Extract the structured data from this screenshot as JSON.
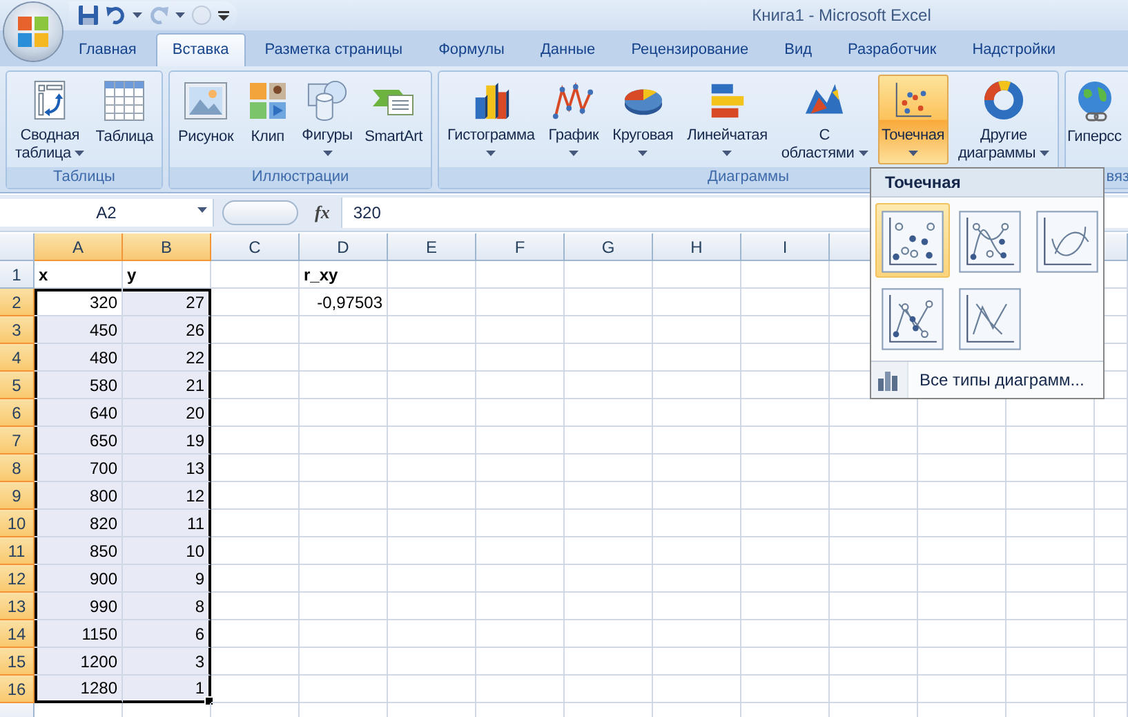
{
  "window": {
    "title": "Книга1 - Microsoft Excel"
  },
  "quick_access": [
    {
      "kind": "save",
      "disabled": false
    },
    {
      "kind": "undo",
      "disabled": false
    },
    {
      "kind": "redo",
      "disabled": true
    },
    {
      "kind": "repeat",
      "disabled": true
    }
  ],
  "tabs": [
    {
      "label": "Главная",
      "selected": false
    },
    {
      "label": "Вставка",
      "selected": true
    },
    {
      "label": "Разметка страницы",
      "selected": false
    },
    {
      "label": "Формулы",
      "selected": false
    },
    {
      "label": "Данные",
      "selected": false
    },
    {
      "label": "Рецензирование",
      "selected": false
    },
    {
      "label": "Вид",
      "selected": false
    },
    {
      "label": "Разработчик",
      "selected": false
    },
    {
      "label": "Надстройки",
      "selected": false
    }
  ],
  "ribbon_groups": [
    {
      "label": "Таблицы",
      "buttons": [
        {
          "kind": "pivot",
          "lines": [
            "Сводная",
            "таблица"
          ],
          "dropdown": true,
          "pressed": false
        },
        {
          "kind": "table",
          "lines": [
            "Таблица"
          ],
          "dropdown": false,
          "pressed": false
        }
      ]
    },
    {
      "label": "Иллюстрации",
      "buttons": [
        {
          "kind": "picture",
          "lines": [
            "Рисунок"
          ],
          "dropdown": false,
          "pressed": false
        },
        {
          "kind": "clip",
          "lines": [
            "Клип"
          ],
          "dropdown": false,
          "pressed": false
        },
        {
          "kind": "shapes",
          "lines": [
            "Фигуры"
          ],
          "dropdown": true,
          "pressed": false
        },
        {
          "kind": "smartart",
          "lines": [
            "SmartArt"
          ],
          "dropdown": false,
          "pressed": false
        }
      ]
    },
    {
      "label": "Диаграммы",
      "buttons": [
        {
          "kind": "column",
          "lines": [
            "Гистограмма"
          ],
          "dropdown": true,
          "pressed": false
        },
        {
          "kind": "line",
          "lines": [
            "График"
          ],
          "dropdown": true,
          "pressed": false
        },
        {
          "kind": "pie",
          "lines": [
            "Круговая"
          ],
          "dropdown": true,
          "pressed": false
        },
        {
          "kind": "bar",
          "lines": [
            "Линейчатая"
          ],
          "dropdown": true,
          "pressed": false
        },
        {
          "kind": "area",
          "lines": [
            "С",
            "областями"
          ],
          "dropdown": true,
          "pressed": false
        },
        {
          "kind": "scatter",
          "lines": [
            "Точечная"
          ],
          "dropdown": true,
          "pressed": true
        },
        {
          "kind": "other",
          "lines": [
            "Другие",
            "диаграммы"
          ],
          "dropdown": true,
          "pressed": false
        }
      ]
    },
    {
      "label": "вяз",
      "buttons": [
        {
          "kind": "hyperlink",
          "lines": [
            "Гиперсс"
          ],
          "dropdown": false,
          "pressed": false
        }
      ]
    }
  ],
  "formula_bar": {
    "name_box": "A2",
    "function_label": "fx",
    "value": "320"
  },
  "sheet": {
    "columns": [
      {
        "label": "A",
        "selected": true
      },
      {
        "label": "B",
        "selected": true
      },
      {
        "label": "C",
        "selected": false
      },
      {
        "label": "D",
        "selected": false
      },
      {
        "label": "E",
        "selected": false
      },
      {
        "label": "F",
        "selected": false
      },
      {
        "label": "G",
        "selected": false
      },
      {
        "label": "H",
        "selected": false
      },
      {
        "label": "I",
        "selected": false
      }
    ],
    "rows": [
      {
        "number": "1",
        "kind": "header",
        "selected": false,
        "cell_a": "x",
        "cell_b": "y",
        "cell_d": "r_xy"
      },
      {
        "number": "2",
        "kind": "data",
        "selected": true,
        "cell_a": "320",
        "cell_b": "27",
        "cell_d": "-0,97503"
      },
      {
        "number": "3",
        "kind": "data",
        "selected": true,
        "cell_a": "450",
        "cell_b": "26"
      },
      {
        "number": "4",
        "kind": "data",
        "selected": true,
        "cell_a": "480",
        "cell_b": "22"
      },
      {
        "number": "5",
        "kind": "data",
        "selected": true,
        "cell_a": "580",
        "cell_b": "21"
      },
      {
        "number": "6",
        "kind": "data",
        "selected": true,
        "cell_a": "640",
        "cell_b": "20"
      },
      {
        "number": "7",
        "kind": "data",
        "selected": true,
        "cell_a": "650",
        "cell_b": "19"
      },
      {
        "number": "8",
        "kind": "data",
        "selected": true,
        "cell_a": "700",
        "cell_b": "13"
      },
      {
        "number": "9",
        "kind": "data",
        "selected": true,
        "cell_a": "800",
        "cell_b": "12"
      },
      {
        "number": "10",
        "kind": "data",
        "selected": true,
        "cell_a": "820",
        "cell_b": "11"
      },
      {
        "number": "11",
        "kind": "data",
        "selected": true,
        "cell_a": "850",
        "cell_b": "10"
      },
      {
        "number": "12",
        "kind": "data",
        "selected": true,
        "cell_a": "900",
        "cell_b": "9"
      },
      {
        "number": "13",
        "kind": "data",
        "selected": true,
        "cell_a": "990",
        "cell_b": "8"
      },
      {
        "number": "14",
        "kind": "data",
        "selected": true,
        "cell_a": "1150",
        "cell_b": "6"
      },
      {
        "number": "15",
        "kind": "data",
        "selected": true,
        "cell_a": "1200",
        "cell_b": "3"
      },
      {
        "number": "16",
        "kind": "data",
        "selected": true,
        "cell_a": "1280",
        "cell_b": "1"
      }
    ]
  },
  "chart_menu": {
    "title": "Точечная",
    "options": [
      {
        "kind": "markers",
        "selected": true
      },
      {
        "kind": "smooth_markers",
        "selected": false
      },
      {
        "kind": "smooth",
        "selected": false
      },
      {
        "kind": "straight_markers",
        "selected": false
      },
      {
        "kind": "straight",
        "selected": false
      }
    ],
    "footer": "Все типы диаграмм..."
  }
}
